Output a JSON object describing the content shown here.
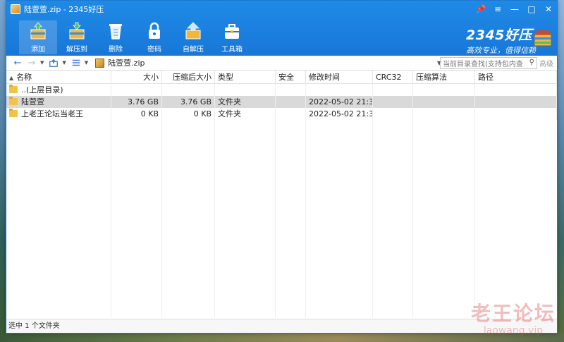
{
  "window": {
    "title": "陆萱萱.zip - 2345好压",
    "controls": [
      "📌",
      "≡",
      "—",
      "□",
      "✕"
    ]
  },
  "toolbar": {
    "items": [
      {
        "label": "添加",
        "icon": "add-archive-icon",
        "active": true
      },
      {
        "label": "解压到",
        "icon": "extract-to-icon",
        "active": false
      },
      {
        "label": "删除",
        "icon": "delete-icon",
        "active": false
      },
      {
        "label": "密码",
        "icon": "lock-icon",
        "active": false
      },
      {
        "label": "自解压",
        "icon": "self-extract-icon",
        "active": false
      },
      {
        "label": "工具箱",
        "icon": "toolbox-icon",
        "active": false
      }
    ]
  },
  "brand": {
    "name": "2345好压",
    "slogan": "高效专业，值得信赖"
  },
  "addressbar": {
    "path": "陆萱萱.zip",
    "search_placeholder": "当前目录查找(支持包内查",
    "advanced_label": "高级"
  },
  "table": {
    "columns": [
      "名称",
      "大小",
      "压缩后大小",
      "类型",
      "安全",
      "修改时间",
      "CRC32",
      "压缩算法",
      "路径"
    ],
    "rows": [
      {
        "name": "..(上层目录)",
        "size": "",
        "packed": "",
        "type": "",
        "security": "",
        "modified": "",
        "crc": "",
        "method": "",
        "path": "",
        "selected": false
      },
      {
        "name": "陆萱萱",
        "size": "3.76 GB",
        "packed": "3.76 GB",
        "type": "文件夹",
        "security": "",
        "modified": "2022-05-02 21:3...",
        "crc": "",
        "method": "",
        "path": "",
        "selected": true
      },
      {
        "name": "上老王论坛当老王",
        "size": "0 KB",
        "packed": "0 KB",
        "type": "文件夹",
        "security": "",
        "modified": "2022-05-02 21:3...",
        "crc": "",
        "method": "",
        "path": "",
        "selected": false
      }
    ]
  },
  "statusbar": {
    "text": "选中 1 个文件夹"
  },
  "watermark": {
    "cn": "老王论坛",
    "en": "laowang.vip"
  },
  "colors": {
    "titlebar": "#1877d8",
    "selected_row": "#d9d9d9",
    "folder": "#f4c24a",
    "accent": "#3a7bd5"
  }
}
